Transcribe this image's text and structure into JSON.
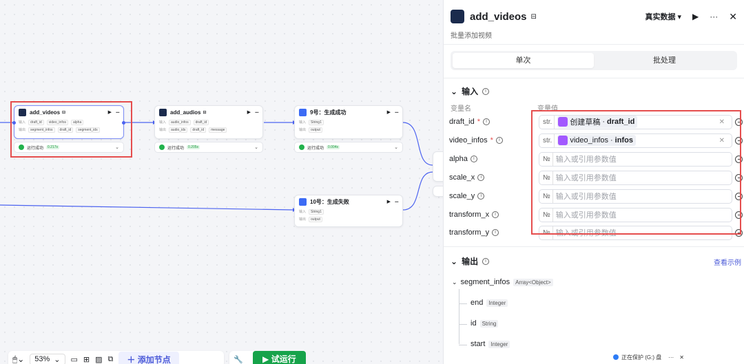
{
  "canvas": {
    "node_add_videos": {
      "title": "add_videos",
      "in_label": "输入",
      "out_label": "输出",
      "inputs": [
        "draft_id",
        "video_infos",
        "alpha"
      ],
      "outputs": [
        "segment_infos",
        "draft_id",
        "segment_ids"
      ],
      "status": "运行成功",
      "time": "0.217s"
    },
    "node_add_audios": {
      "title": "add_audios",
      "in_label": "输入",
      "out_label": "输出",
      "inputs": [
        "audio_infos",
        "draft_id"
      ],
      "outputs": [
        "audio_ids",
        "draft_id",
        "message"
      ],
      "status": "运行成功",
      "time": "0.205s"
    },
    "node_9": {
      "title": "9号：生成成功",
      "in_label": "输入",
      "out_label": "输出",
      "input": "String1",
      "output": "output",
      "status": "运行成功",
      "time": "0.004s"
    },
    "node_10": {
      "title": "10号：生成失败",
      "in_label": "输入",
      "out_label": "输出",
      "input": "String1",
      "output": "output"
    },
    "toolbar": {
      "zoom": "53%",
      "add_node": "添加节点",
      "test_run": "试运行"
    }
  },
  "panel": {
    "title": "add_videos",
    "subtitle": "批量添加视频",
    "data_mode": "真实数据",
    "tabs": [
      "单次",
      "批处理"
    ],
    "input_section": "输入",
    "col_name": "变量名",
    "col_value": "变量值",
    "params": [
      {
        "name": "draft_id",
        "required": "*",
        "type": "str.",
        "ref_node": "创建草稿",
        "ref_field": "draft_id"
      },
      {
        "name": "video_infos",
        "required": "*",
        "type": "str.",
        "ref_node": "video_infos",
        "ref_field": "infos"
      },
      {
        "name": "alpha",
        "type": "№",
        "placeholder": "输入或引用参数值"
      },
      {
        "name": "scale_x",
        "type": "№",
        "placeholder": "输入或引用参数值"
      },
      {
        "name": "scale_y",
        "type": "№",
        "placeholder": "输入或引用参数值"
      },
      {
        "name": "transform_x",
        "type": "№",
        "placeholder": "输入或引用参数值"
      },
      {
        "name": "transform_y",
        "type": "№",
        "placeholder": "输入或引用参数值"
      }
    ],
    "output_section": "输出",
    "view_example": "查看示例",
    "outputs": {
      "root": "segment_infos",
      "root_type": "Array<Object>",
      "children": [
        {
          "name": "end",
          "type": "Integer"
        },
        {
          "name": "id",
          "type": "String"
        },
        {
          "name": "start",
          "type": "Integer"
        }
      ]
    }
  },
  "toast": {
    "text": "正在保护 (G:) 盘"
  }
}
